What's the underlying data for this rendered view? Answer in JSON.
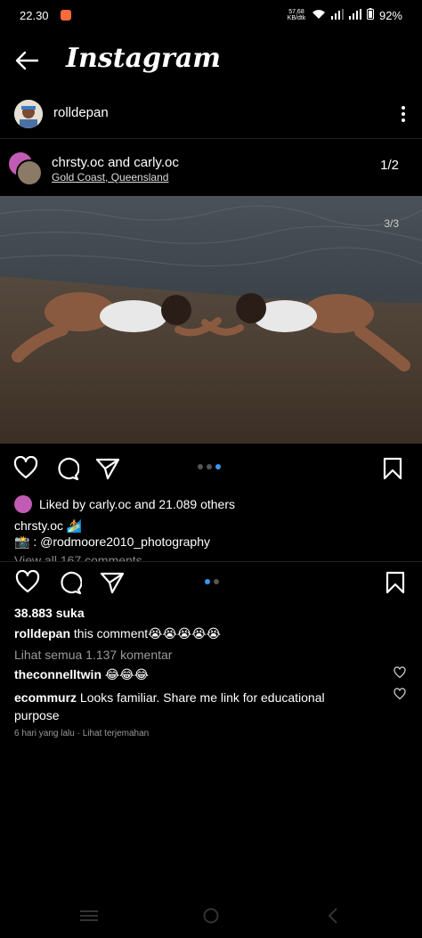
{
  "status_bar": {
    "time": "22.30",
    "speed": "57,68 KB/dtk",
    "battery": "92%"
  },
  "header": {
    "title": "Instagram"
  },
  "post_author": {
    "username": "rolldepan"
  },
  "embedded_post": {
    "usernames": "chrsty.oc and carly.oc",
    "location": "Gold Coast, Queensland",
    "page_indicator": "1/2",
    "image_counter": "3/3",
    "liked_by": "Liked by carly.oc and 21.089 others",
    "caption_user": "chrsty.oc",
    "caption_line2": "📸 : @rodmoore2010_photography",
    "view_all": "View all 167 comments"
  },
  "outer_post": {
    "likes": "38.883 suka",
    "caption_user": "rolldepan",
    "caption_text": " this comment😭😭😭😭😭",
    "view_comments": "Lihat semua 1.137 komentar",
    "comments": [
      {
        "user": "theconnelltwin",
        "text": " 😂😂😂"
      },
      {
        "user": "ecommurz",
        "text": " Looks familiar. Share me link for educational purpose"
      }
    ],
    "meta": "6 hari yang lalu · Lihat terjemahan"
  },
  "colors": {
    "accent": "#3897f0",
    "background": "#000000"
  }
}
